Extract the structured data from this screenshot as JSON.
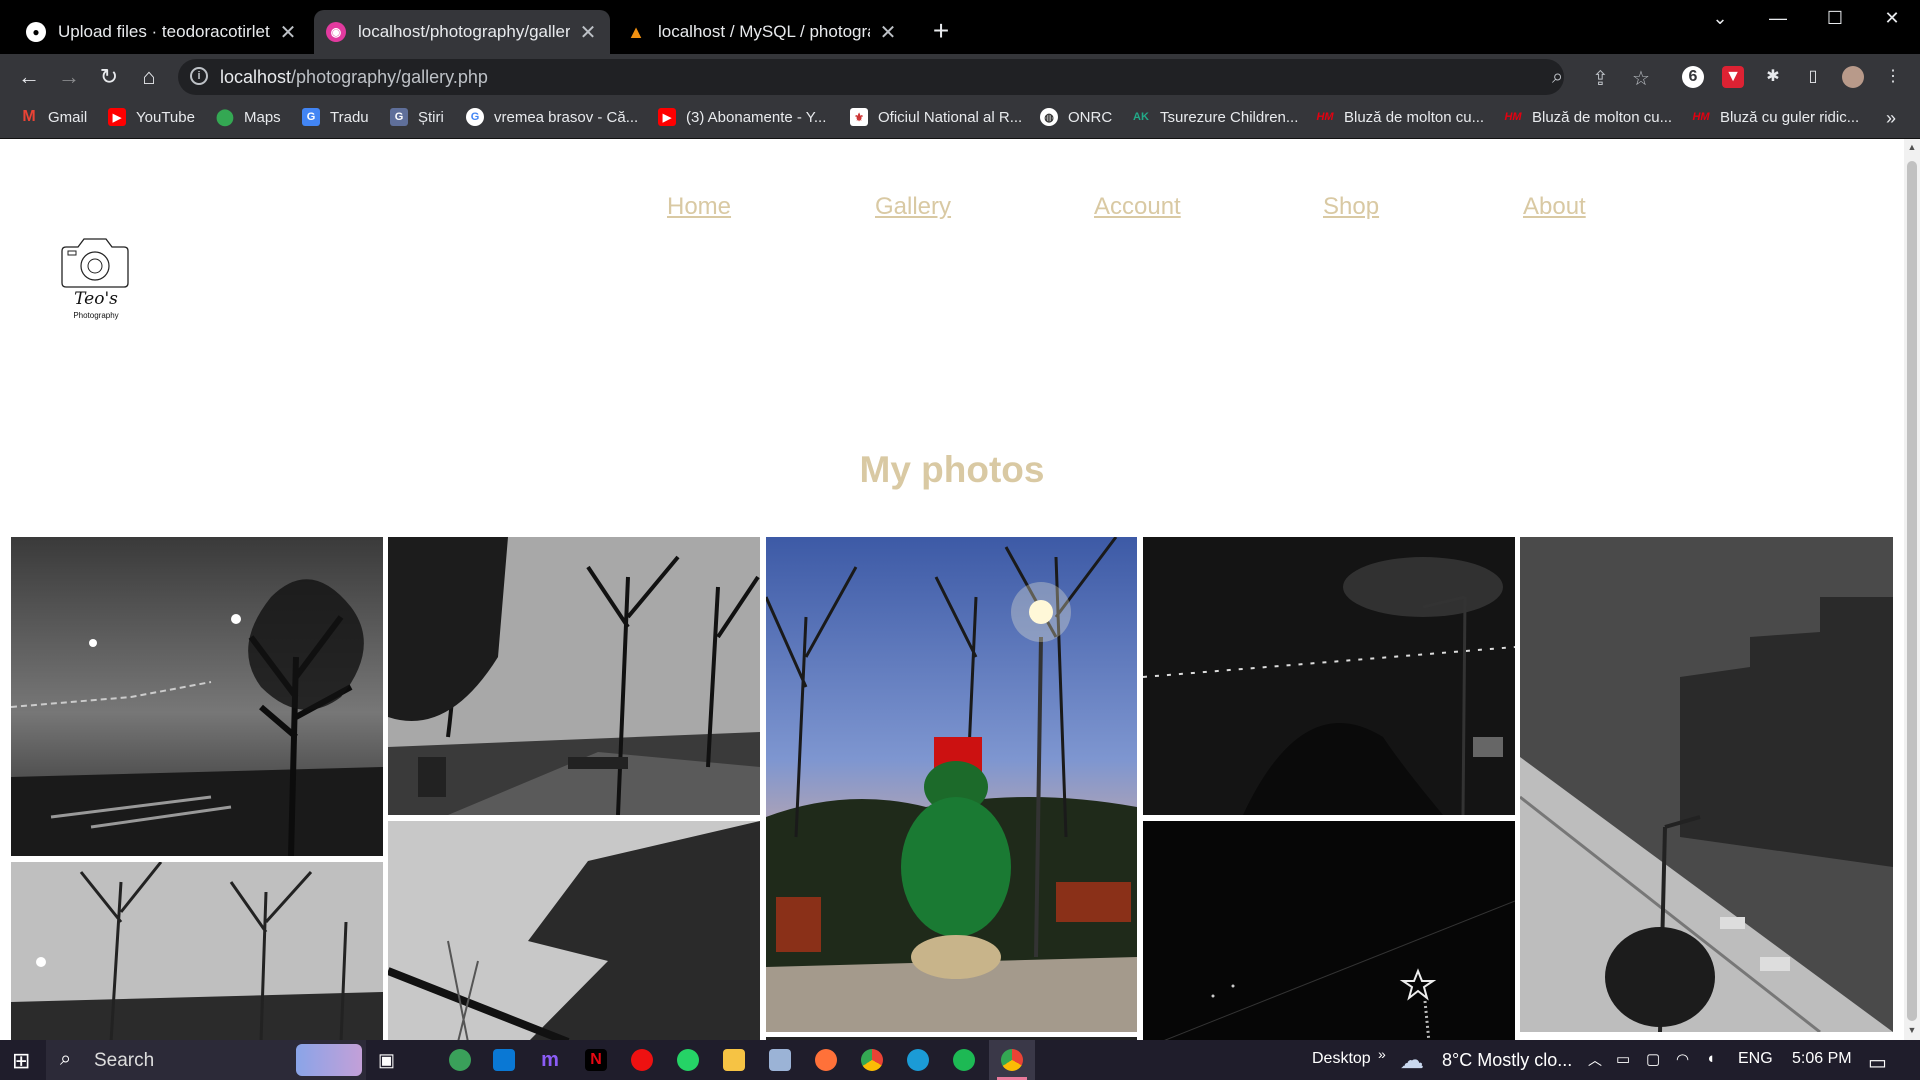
{
  "browser": {
    "tabs": [
      {
        "title": "Upload files · teodoracotirlet/we",
        "active": false,
        "icon": "github-icon"
      },
      {
        "title": "localhost/photography/gallery.ph",
        "active": true,
        "icon": "site-icon"
      },
      {
        "title": "localhost / MySQL / photography",
        "active": false,
        "icon": "phpmyadmin-icon"
      }
    ],
    "address": {
      "host": "localhost",
      "path": "/photography/gallery.php"
    },
    "bookmarks": [
      "Gmail",
      "YouTube",
      "Maps",
      "Tradu",
      "Știri",
      "vremea brasov - Că...",
      "(3) Abonamente - Y...",
      "Oficiul National al R...",
      "ONRC",
      "Tsurezure Children...",
      "Bluză de molton cu...",
      "Bluză de molton cu...",
      "Bluză cu guler ridic..."
    ]
  },
  "site": {
    "logo_text": "Teo's",
    "logo_sub": "Photography",
    "nav": [
      "Home",
      "Gallery",
      "Account",
      "Shop",
      "About"
    ],
    "heading": "My photos",
    "accent_color": "#d9c9a3"
  },
  "taskbar": {
    "search": "Search",
    "desktop": "Desktop",
    "weather": "8°C  Mostly clo...",
    "lang": "ENG",
    "time": "5:06 PM"
  }
}
